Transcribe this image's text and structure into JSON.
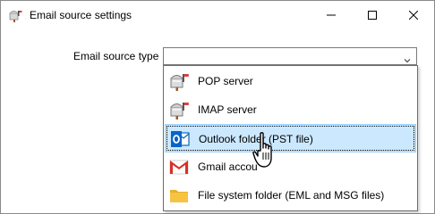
{
  "window": {
    "title": "Email source settings",
    "icons": {
      "app": "mailbox-icon",
      "minimize": "minimize-icon",
      "maximize": "maximize-icon",
      "close": "close-icon"
    }
  },
  "form": {
    "source_type_label": "Email source type",
    "source_type_value": ""
  },
  "dropdown": {
    "items": [
      {
        "label": "POP server",
        "icon": "mailbox-icon",
        "selected": false
      },
      {
        "label": "IMAP server",
        "icon": "mailbox-icon",
        "selected": false
      },
      {
        "label": "Outlook folder (PST file)",
        "icon": "outlook-icon",
        "selected": true
      },
      {
        "label": "Gmail accou",
        "icon": "gmail-icon",
        "selected": false
      },
      {
        "label": "File system folder (EML and MSG files)",
        "icon": "folder-icon",
        "selected": false
      }
    ]
  },
  "colors": {
    "selection_fill": "#cce8ff",
    "selection_border": "#99d1ff",
    "outlook_blue": "#0a64c8",
    "gmail_red": "#d93025",
    "folder_yellow": "#f6c343"
  }
}
